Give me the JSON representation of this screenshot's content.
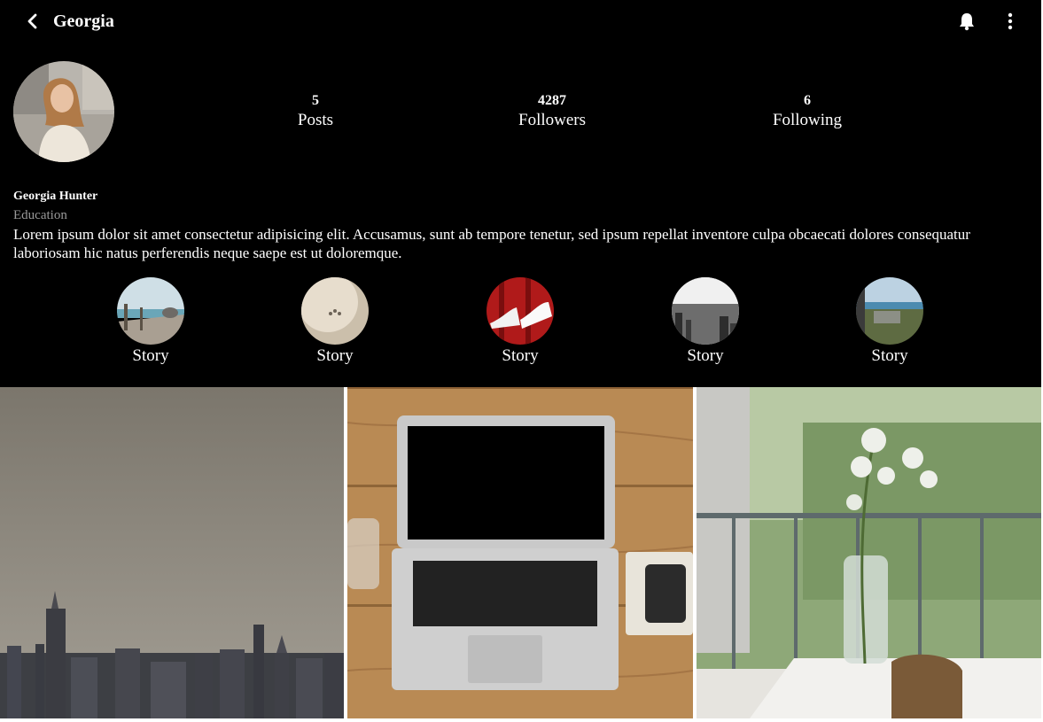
{
  "header": {
    "title": "Georgia",
    "back_icon": "chevron-left-icon",
    "notifications_icon": "bell-icon",
    "menu_icon": "more-vertical-icon"
  },
  "stats": {
    "posts": {
      "value": "5",
      "label": "Posts"
    },
    "followers": {
      "value": "4287",
      "label": "Followers"
    },
    "following": {
      "value": "6",
      "label": "Following"
    }
  },
  "bio": {
    "name": "Georgia Hunter",
    "category": "Education",
    "text": "Lorem ipsum dolor sit amet consectetur adipisicing elit. Accusamus, sunt ab tempore tenetur, sed ipsum repellat inventore culpa obcaecati dolores consequatur laboriosam hic natus perferendis neque saepe est ut doloremque."
  },
  "stories": [
    {
      "label": "Story"
    },
    {
      "label": "Story"
    },
    {
      "label": "Story"
    },
    {
      "label": "Story"
    },
    {
      "label": "Story"
    }
  ],
  "colors": {
    "background": "#000000",
    "text": "#ffffff",
    "muted": "#9a9a9a"
  }
}
